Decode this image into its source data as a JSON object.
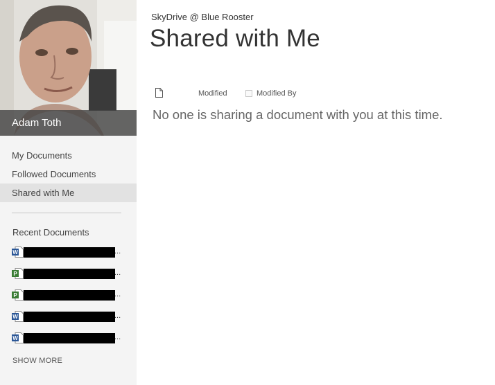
{
  "profile": {
    "name": "Adam Toth"
  },
  "nav": {
    "items": [
      {
        "label": "My Documents",
        "selected": false
      },
      {
        "label": "Followed Documents",
        "selected": false
      },
      {
        "label": "Shared with Me",
        "selected": true
      }
    ]
  },
  "recent": {
    "title": "Recent Documents",
    "items": [
      {
        "icon": "word-doc-icon",
        "ellipsis": "..."
      },
      {
        "icon": "project-doc-icon",
        "ellipsis": "..."
      },
      {
        "icon": "project-doc-icon",
        "ellipsis": "..."
      },
      {
        "icon": "word-doc-icon",
        "ellipsis": "..."
      },
      {
        "icon": "word-doc-icon",
        "ellipsis": "..."
      }
    ],
    "show_more": "SHOW MORE"
  },
  "header": {
    "breadcrumb": "SkyDrive @ Blue Rooster",
    "title": "Shared with Me"
  },
  "table": {
    "columns": {
      "modified": "Modified",
      "modified_by": "Modified By"
    },
    "empty_message": "No one is sharing a document with you at this time."
  },
  "colors": {
    "sidebar_bg": "#f4f4f4",
    "selected_bg": "#e2e2e2",
    "name_bar": "#464646",
    "word_blue": "#2b5797",
    "project_green": "#3a7d34"
  }
}
